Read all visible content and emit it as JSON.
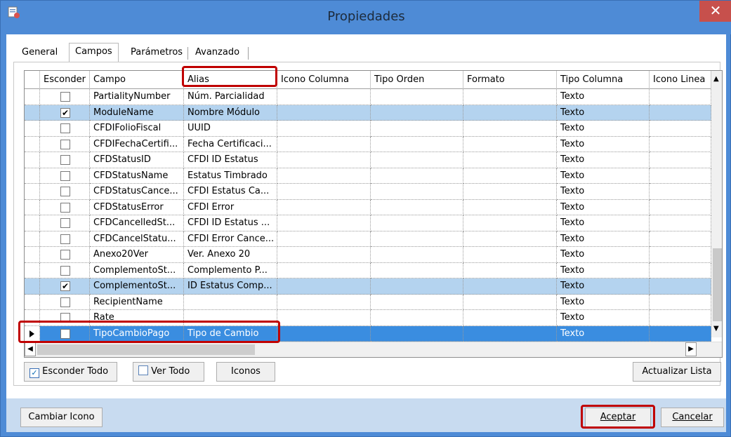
{
  "window": {
    "title": "Propiedades",
    "close_label": "✕"
  },
  "tabs": [
    {
      "label": "General"
    },
    {
      "label": "Campos"
    },
    {
      "label": "Parámetros"
    },
    {
      "label": "Avanzado"
    }
  ],
  "grid": {
    "headers": [
      "Esconder",
      "Campo",
      "Alias",
      "Icono Columna",
      "Tipo Orden",
      "Formato",
      "Tipo Columna",
      "Icono Linea"
    ],
    "rows": [
      {
        "checked": false,
        "campo": "PartialityNumber",
        "alias": "Núm. Parcialidad",
        "tipo": "Texto",
        "state": "normal"
      },
      {
        "checked": true,
        "campo": "ModuleName",
        "alias": "Nombre Módulo",
        "tipo": "Texto",
        "state": "selected"
      },
      {
        "checked": false,
        "campo": "CFDIFolioFiscal",
        "alias": "UUID",
        "tipo": "Texto",
        "state": "normal"
      },
      {
        "checked": false,
        "campo": "CFDIFechaCertifi...",
        "alias": "Fecha Certificaci...",
        "tipo": "Texto",
        "state": "normal"
      },
      {
        "checked": false,
        "campo": "CFDStatusID",
        "alias": "CFDI ID Estatus",
        "tipo": "Texto",
        "state": "normal"
      },
      {
        "checked": false,
        "campo": "CFDStatusName",
        "alias": "Estatus Timbrado",
        "tipo": "Texto",
        "state": "normal"
      },
      {
        "checked": false,
        "campo": "CFDStatusCance...",
        "alias": "CFDI Estatus Ca...",
        "tipo": "Texto",
        "state": "normal"
      },
      {
        "checked": false,
        "campo": "CFDStatusError",
        "alias": "CFDI Error",
        "tipo": "Texto",
        "state": "normal"
      },
      {
        "checked": false,
        "campo": "CFDCancelledSt...",
        "alias": "CFDI ID Estatus ...",
        "tipo": "Texto",
        "state": "normal"
      },
      {
        "checked": false,
        "campo": "CFDCancelStatu...",
        "alias": "CFDI Error Cance...",
        "tipo": "Texto",
        "state": "normal"
      },
      {
        "checked": false,
        "campo": "Anexo20Ver",
        "alias": "Ver. Anexo 20",
        "tipo": "Texto",
        "state": "normal"
      },
      {
        "checked": false,
        "campo": "ComplementoSt...",
        "alias": "Complemento P...",
        "tipo": "Texto",
        "state": "normal"
      },
      {
        "checked": true,
        "campo": "ComplementoSt...",
        "alias": "ID Estatus Comp...",
        "tipo": "Texto",
        "state": "selected"
      },
      {
        "checked": false,
        "campo": "RecipientName",
        "alias": "",
        "tipo": "Texto",
        "state": "normal"
      },
      {
        "checked": false,
        "campo": "Rate",
        "alias": "",
        "tipo": "Texto",
        "state": "normal"
      },
      {
        "checked": false,
        "campo": "TipoCambioPago",
        "alias": "Tipo de Cambio",
        "tipo": "Texto",
        "state": "current"
      }
    ]
  },
  "buttons": {
    "esconder_todo": "Esconder Todo",
    "ver_todo": "Ver Todo",
    "iconos": "Iconos",
    "actualizar_lista": "Actualizar Lista",
    "cambiar_icono": "Cambiar Icono",
    "aceptar": "Aceptar",
    "cancelar": "Cancelar"
  },
  "colors": {
    "highlight": "#c00000",
    "selected_row": "#b4d3ef",
    "current_row": "#3a8de0"
  }
}
